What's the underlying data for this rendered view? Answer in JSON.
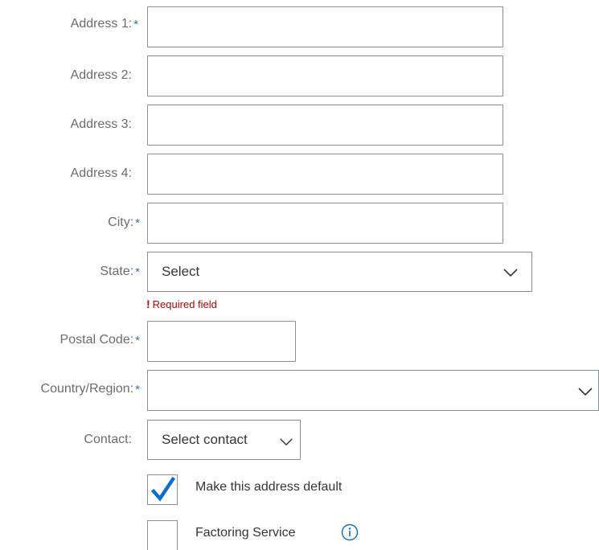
{
  "form": {
    "address1": {
      "label": "Address 1:",
      "required": "*",
      "value": ""
    },
    "address2": {
      "label": "Address 2:",
      "value": ""
    },
    "address3": {
      "label": "Address 3:",
      "value": ""
    },
    "address4": {
      "label": "Address 4:",
      "value": ""
    },
    "city": {
      "label": "City:",
      "required": "*",
      "value": ""
    },
    "state": {
      "label": "State:",
      "required": "*",
      "selected": "Select",
      "error": "Required field",
      "error_mark": "!"
    },
    "postal_code": {
      "label": "Postal Code:",
      "required": "*",
      "value": ""
    },
    "country_region": {
      "label": "Country/Region:",
      "required": "*",
      "selected": ""
    },
    "contact": {
      "label": "Contact:",
      "selected": "Select contact"
    },
    "make_default": {
      "label": "Make this address default",
      "checked": true
    },
    "factoring_service": {
      "label": "Factoring Service",
      "checked": false,
      "info_icon": "info-icon"
    }
  },
  "colors": {
    "label": "#6a6d70",
    "required_star": "#3b6ea5",
    "border": "#89919a",
    "error": "#bb0000",
    "checkmark": "#0a6ed1",
    "info": "#0a6ed1"
  }
}
